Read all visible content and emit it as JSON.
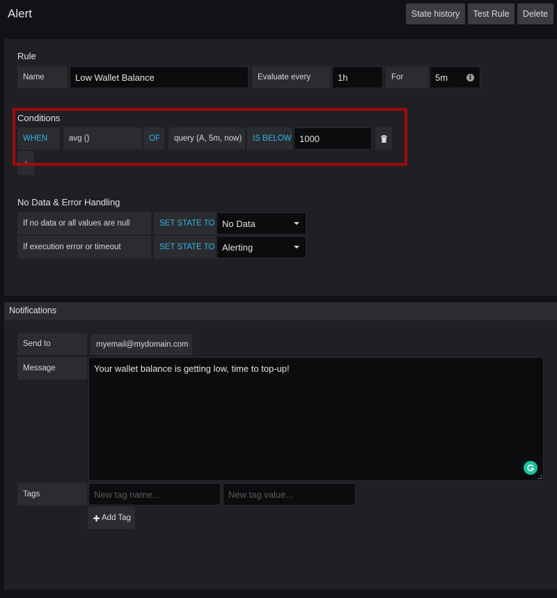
{
  "page": {
    "title": "Alert"
  },
  "toolbar": {
    "state_history": "State history",
    "test_rule": "Test Rule",
    "delete": "Delete"
  },
  "rule": {
    "heading": "Rule",
    "name_label": "Name",
    "name_value": "Low Wallet Balance",
    "evaluate_label": "Evaluate every",
    "evaluate_value": "1h",
    "for_label": "For",
    "for_value": "5m"
  },
  "conditions": {
    "heading": "Conditions",
    "when": "WHEN",
    "func": "avg ()",
    "of": "OF",
    "query": "query (A, 5m, now)",
    "comparator": "IS BELOW",
    "threshold": "1000",
    "add_symbol": "+"
  },
  "nodata": {
    "heading": "No Data & Error Handling",
    "rows": [
      {
        "label": "If no data or all values are null",
        "action": "SET STATE TO",
        "value": "No Data"
      },
      {
        "label": "If execution error or timeout",
        "action": "SET STATE TO",
        "value": "Alerting"
      }
    ]
  },
  "notifications": {
    "heading": "Notifications",
    "send_to_label": "Send to",
    "send_to_value": "myemail@mydomain.com",
    "message_label": "Message",
    "message_value": "Your wallet balance is getting low, time to top-up!",
    "tags_label": "Tags",
    "tag_name_placeholder": "New tag name...",
    "tag_value_placeholder": "New tag value...",
    "add_tag": "Add Tag"
  },
  "colors": {
    "accent": "#33b5e5",
    "highlight": "#a10a0f",
    "background": "#111216",
    "panel": "#1f2024"
  },
  "icons": {
    "info": "info-icon",
    "trash": "trash-icon",
    "plus": "plus-icon",
    "grammarly": "grammarly-icon"
  }
}
